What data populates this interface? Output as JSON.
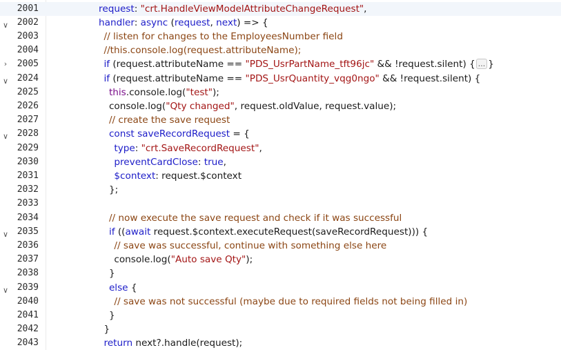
{
  "editor": {
    "lines": [
      {
        "num": "2001",
        "indent": 9,
        "fold": "",
        "current": true,
        "tokens": [
          {
            "t": "request",
            "c": "prop"
          },
          {
            "t": ": ",
            "c": "plain"
          },
          {
            "t": "\"crt.HandleViewModelAttributeChangeRequest\"",
            "c": "str"
          },
          {
            "t": ",",
            "c": "plain"
          }
        ]
      },
      {
        "num": "2002",
        "indent": 9,
        "fold": "expanded",
        "tokens": [
          {
            "t": "handler",
            "c": "prop"
          },
          {
            "t": ": ",
            "c": "plain"
          },
          {
            "t": "async",
            "c": "kw"
          },
          {
            "t": " (",
            "c": "plain"
          },
          {
            "t": "request",
            "c": "kw"
          },
          {
            "t": ", ",
            "c": "plain"
          },
          {
            "t": "next",
            "c": "kw"
          },
          {
            "t": ") => {",
            "c": "plain"
          }
        ]
      },
      {
        "num": "2003",
        "indent": 10,
        "fold": "",
        "tokens": [
          {
            "t": "// listen for changes to the EmployeesNumber field",
            "c": "com"
          }
        ]
      },
      {
        "num": "2004",
        "indent": 10,
        "fold": "",
        "tokens": [
          {
            "t": "//this.console.log(request.attributeName);",
            "c": "com"
          }
        ]
      },
      {
        "num": "2005",
        "indent": 10,
        "fold": "collapsed",
        "tokens": [
          {
            "t": "if",
            "c": "kw"
          },
          {
            "t": " (request.attributeName == ",
            "c": "plain"
          },
          {
            "t": "\"PDS_UsrPartName_tft96jc\"",
            "c": "str"
          },
          {
            "t": " && !request.silent) {",
            "c": "plain"
          },
          {
            "t": "...",
            "c": "ellipsis"
          },
          {
            "t": "}",
            "c": "plain"
          }
        ]
      },
      {
        "num": "2024",
        "indent": 10,
        "fold": "expanded",
        "tokens": [
          {
            "t": "if",
            "c": "kw"
          },
          {
            "t": " (request.attributeName == ",
            "c": "plain"
          },
          {
            "t": "\"PDS_UsrQuantity_vqg0ngo\"",
            "c": "str"
          },
          {
            "t": " && !request.silent) {",
            "c": "plain"
          }
        ]
      },
      {
        "num": "2025",
        "indent": 11,
        "fold": "",
        "tokens": [
          {
            "t": "this",
            "c": "this"
          },
          {
            "t": ".console.log(",
            "c": "plain"
          },
          {
            "t": "\"test\"",
            "c": "str"
          },
          {
            "t": ");",
            "c": "plain"
          }
        ]
      },
      {
        "num": "2026",
        "indent": 11,
        "fold": "",
        "tokens": [
          {
            "t": "console.log(",
            "c": "plain"
          },
          {
            "t": "\"Qty changed\"",
            "c": "str"
          },
          {
            "t": ", request.oldValue, request.value);",
            "c": "plain"
          }
        ]
      },
      {
        "num": "2027",
        "indent": 11,
        "fold": "",
        "tokens": [
          {
            "t": "// create the save request",
            "c": "com"
          }
        ]
      },
      {
        "num": "2028",
        "indent": 11,
        "fold": "expanded",
        "tokens": [
          {
            "t": "const",
            "c": "kw"
          },
          {
            "t": " ",
            "c": "plain"
          },
          {
            "t": "saveRecordRequest",
            "c": "kw"
          },
          {
            "t": " = {",
            "c": "plain"
          }
        ]
      },
      {
        "num": "2029",
        "indent": 12,
        "fold": "",
        "tokens": [
          {
            "t": "type",
            "c": "prop"
          },
          {
            "t": ": ",
            "c": "plain"
          },
          {
            "t": "\"crt.SaveRecordRequest\"",
            "c": "str"
          },
          {
            "t": ",",
            "c": "plain"
          }
        ]
      },
      {
        "num": "2030",
        "indent": 12,
        "fold": "",
        "tokens": [
          {
            "t": "preventCardClose",
            "c": "prop"
          },
          {
            "t": ": ",
            "c": "plain"
          },
          {
            "t": "true",
            "c": "kw"
          },
          {
            "t": ",",
            "c": "plain"
          }
        ]
      },
      {
        "num": "2031",
        "indent": 12,
        "fold": "",
        "tokens": [
          {
            "t": "$context",
            "c": "prop"
          },
          {
            "t": ": request.$context",
            "c": "plain"
          }
        ]
      },
      {
        "num": "2032",
        "indent": 11,
        "fold": "",
        "tokens": [
          {
            "t": "};",
            "c": "plain"
          }
        ]
      },
      {
        "num": "2033",
        "indent": 0,
        "fold": "",
        "tokens": []
      },
      {
        "num": "2034",
        "indent": 11,
        "fold": "",
        "tokens": [
          {
            "t": "// now execute the save request and check if it was successful",
            "c": "com"
          }
        ]
      },
      {
        "num": "2035",
        "indent": 11,
        "fold": "expanded",
        "tokens": [
          {
            "t": "if",
            "c": "kw"
          },
          {
            "t": " ((",
            "c": "plain"
          },
          {
            "t": "await",
            "c": "kw"
          },
          {
            "t": " request.$context.executeRequest(saveRecordRequest))) {",
            "c": "plain"
          }
        ]
      },
      {
        "num": "2036",
        "indent": 12,
        "fold": "",
        "tokens": [
          {
            "t": "// save was successful, continue with something else here",
            "c": "com"
          }
        ]
      },
      {
        "num": "2037",
        "indent": 12,
        "fold": "",
        "tokens": [
          {
            "t": "console.log(",
            "c": "plain"
          },
          {
            "t": "\"Auto save Qty\"",
            "c": "str"
          },
          {
            "t": ");",
            "c": "plain"
          }
        ]
      },
      {
        "num": "2038",
        "indent": 11,
        "fold": "",
        "tokens": [
          {
            "t": "}",
            "c": "plain"
          }
        ]
      },
      {
        "num": "2039",
        "indent": 11,
        "fold": "expanded",
        "tokens": [
          {
            "t": "else",
            "c": "kw"
          },
          {
            "t": " {",
            "c": "plain"
          }
        ]
      },
      {
        "num": "2040",
        "indent": 12,
        "fold": "",
        "tokens": [
          {
            "t": "// save was not successful (maybe due to required fields not being filled in)",
            "c": "com"
          }
        ]
      },
      {
        "num": "2041",
        "indent": 11,
        "fold": "",
        "tokens": [
          {
            "t": "}",
            "c": "plain"
          }
        ]
      },
      {
        "num": "2042",
        "indent": 10,
        "fold": "",
        "tokens": [
          {
            "t": "}",
            "c": "plain"
          }
        ]
      },
      {
        "num": "2043",
        "indent": 10,
        "fold": "",
        "tokens": [
          {
            "t": "return",
            "c": "kw"
          },
          {
            "t": " next?.handle(request);",
            "c": "plain"
          }
        ]
      }
    ],
    "fold_icons": {
      "expanded": "∨",
      "collapsed": "›"
    },
    "colors": {
      "keyword": "#1c1cc8",
      "string": "#a31515",
      "comment": "#8b4513",
      "this": "#7a0e8a",
      "plain": "#1a1a1a",
      "current_line": "#f2f6fb"
    }
  }
}
